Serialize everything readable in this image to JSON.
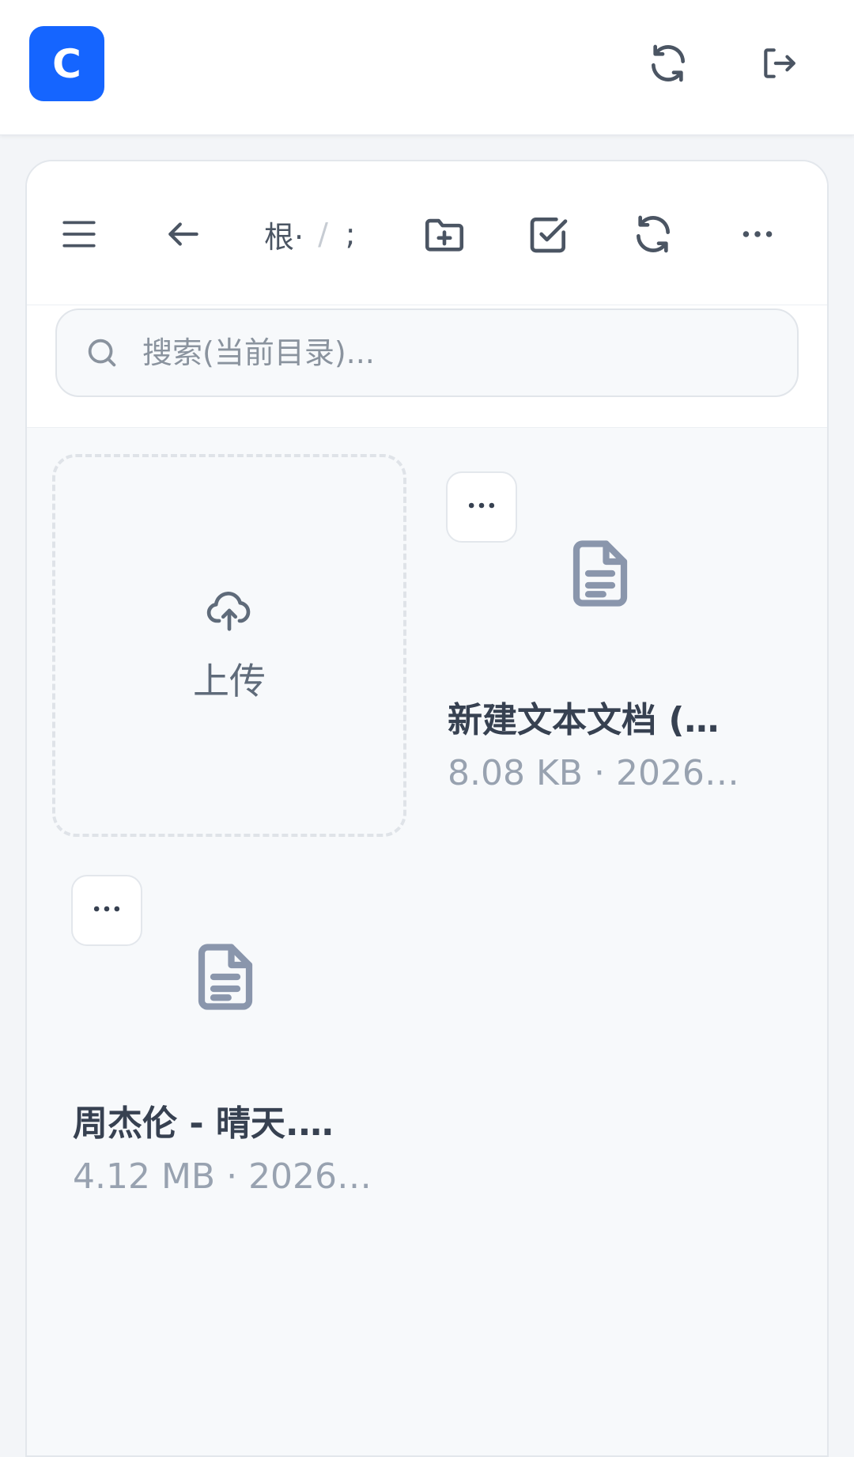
{
  "header": {
    "logo_letter": "C",
    "icons": [
      "refresh-icon",
      "logout-icon"
    ]
  },
  "toolbar": {
    "breadcrumb": [
      "根·",
      "/",
      " ;"
    ],
    "icons": [
      "menu-icon",
      "back-arrow-icon",
      "new-folder-icon",
      "checkbox-icon",
      "refresh-icon",
      "more-icon"
    ]
  },
  "search": {
    "placeholder": "搜索(当前目录)..."
  },
  "upload": {
    "label": "上传"
  },
  "files": [
    {
      "name": "新建文本文档 (…",
      "meta": "8.08 KB · 2026…"
    },
    {
      "name": "周杰伦 - 晴天.…",
      "meta": "4.12 MB · 2026…"
    }
  ],
  "colors": {
    "brand": "#1565ff",
    "icon": "#4b5563",
    "file_icon": "#8a96ac"
  }
}
